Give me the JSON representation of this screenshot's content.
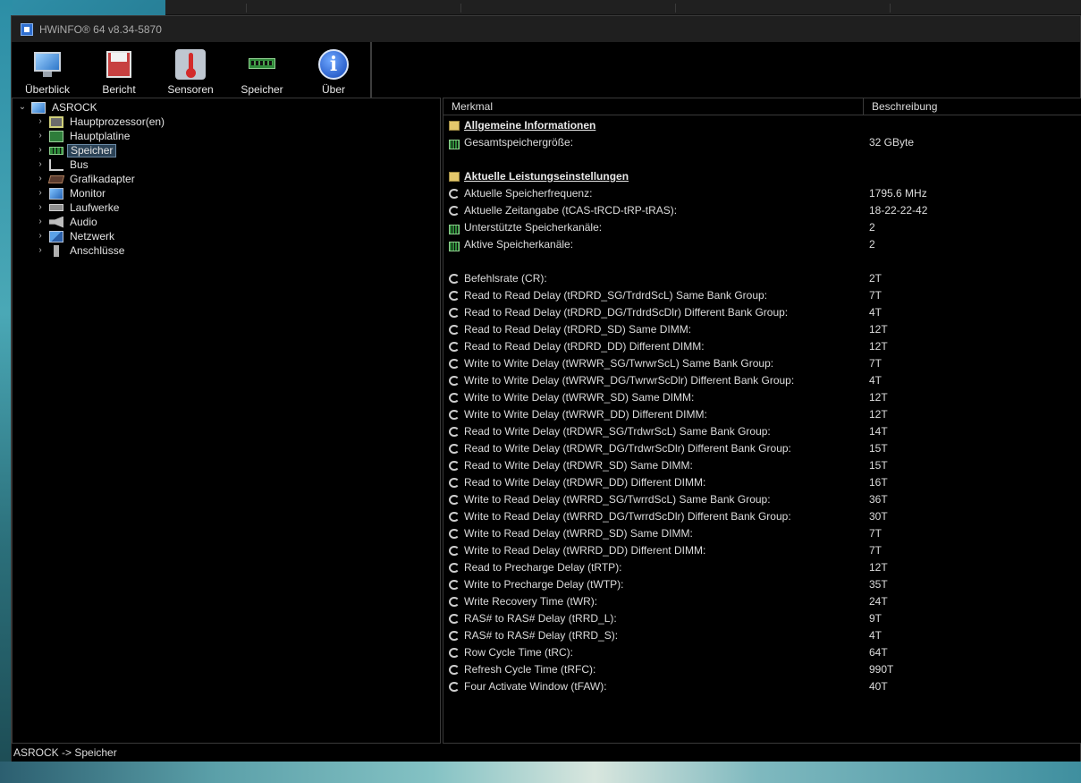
{
  "window": {
    "title": "HWiNFO® 64 v8.34-5870"
  },
  "toolbar": {
    "buttons": [
      {
        "label": "Überblick",
        "icon": "monitor-icon"
      },
      {
        "label": "Bericht",
        "icon": "floppy-icon"
      },
      {
        "label": "Sensoren",
        "icon": "thermometer-icon"
      },
      {
        "label": "Speicher",
        "icon": "ram-icon"
      },
      {
        "label": "Über",
        "icon": "info-icon"
      }
    ]
  },
  "tree": {
    "root": "ASROCK",
    "items": [
      {
        "label": "Hauptprozessor(en)",
        "icon": "cpu-icon"
      },
      {
        "label": "Hauptplatine",
        "icon": "motherboard-icon"
      },
      {
        "label": "Speicher",
        "icon": "ram-icon",
        "selected": true
      },
      {
        "label": "Bus",
        "icon": "bus-icon"
      },
      {
        "label": "Grafikadapter",
        "icon": "gpu-icon"
      },
      {
        "label": "Monitor",
        "icon": "monitor-icon"
      },
      {
        "label": "Laufwerke",
        "icon": "drive-icon"
      },
      {
        "label": "Audio",
        "icon": "audio-icon"
      },
      {
        "label": "Netzwerk",
        "icon": "network-icon"
      },
      {
        "label": "Anschlüsse",
        "icon": "port-icon"
      }
    ]
  },
  "detail": {
    "headers": {
      "feature": "Merkmal",
      "description": "Beschreibung"
    },
    "rows": [
      {
        "label": "Allgemeine Informationen",
        "value": "",
        "type": "section",
        "icon": "section-icon"
      },
      {
        "label": "Gesamtspeichergröße:",
        "value": "32 GByte",
        "type": "row",
        "icon": "ram-icon"
      },
      {
        "label": "",
        "value": "",
        "type": "blank",
        "icon": ""
      },
      {
        "label": "Aktuelle Leistungseinstellungen",
        "value": "",
        "type": "section",
        "icon": "section-icon"
      },
      {
        "label": "Aktuelle Speicherfrequenz:",
        "value": "1795.6 MHz",
        "type": "row",
        "icon": "clock-icon"
      },
      {
        "label": "Aktuelle Zeitangabe (tCAS-tRCD-tRP-tRAS):",
        "value": "18-22-22-42",
        "type": "row",
        "icon": "clock-icon"
      },
      {
        "label": "Unterstützte Speicherkanäle:",
        "value": "2",
        "type": "row",
        "icon": "ram-icon"
      },
      {
        "label": "Aktive Speicherkanäle:",
        "value": "2",
        "type": "row",
        "icon": "ram-icon"
      },
      {
        "label": "",
        "value": "",
        "type": "blank",
        "icon": ""
      },
      {
        "label": "Befehlsrate (CR):",
        "value": "2T",
        "type": "row",
        "icon": "clock-icon"
      },
      {
        "label": "Read to Read Delay (tRDRD_SG/TrdrdScL) Same Bank Group:",
        "value": "7T",
        "type": "row",
        "icon": "clock-icon"
      },
      {
        "label": "Read to Read Delay (tRDRD_DG/TrdrdScDlr) Different Bank Group:",
        "value": "4T",
        "type": "row",
        "icon": "clock-icon"
      },
      {
        "label": "Read to Read Delay (tRDRD_SD) Same DIMM:",
        "value": "12T",
        "type": "row",
        "icon": "clock-icon"
      },
      {
        "label": "Read to Read Delay (tRDRD_DD) Different DIMM:",
        "value": "12T",
        "type": "row",
        "icon": "clock-icon"
      },
      {
        "label": "Write to Write Delay (tWRWR_SG/TwrwrScL) Same Bank Group:",
        "value": "7T",
        "type": "row",
        "icon": "clock-icon"
      },
      {
        "label": "Write to Write Delay (tWRWR_DG/TwrwrScDlr) Different Bank Group:",
        "value": "4T",
        "type": "row",
        "icon": "clock-icon"
      },
      {
        "label": "Write to Write Delay (tWRWR_SD) Same DIMM:",
        "value": "12T",
        "type": "row",
        "icon": "clock-icon"
      },
      {
        "label": "Write to Write Delay (tWRWR_DD) Different DIMM:",
        "value": "12T",
        "type": "row",
        "icon": "clock-icon"
      },
      {
        "label": "Read to Write Delay (tRDWR_SG/TrdwrScL) Same Bank Group:",
        "value": "14T",
        "type": "row",
        "icon": "clock-icon"
      },
      {
        "label": "Read to Write Delay (tRDWR_DG/TrdwrScDlr) Different Bank Group:",
        "value": "15T",
        "type": "row",
        "icon": "clock-icon"
      },
      {
        "label": "Read to Write Delay (tRDWR_SD) Same DIMM:",
        "value": "15T",
        "type": "row",
        "icon": "clock-icon"
      },
      {
        "label": "Read to Write Delay (tRDWR_DD) Different DIMM:",
        "value": "16T",
        "type": "row",
        "icon": "clock-icon"
      },
      {
        "label": "Write to Read Delay (tWRRD_SG/TwrrdScL) Same Bank Group:",
        "value": "36T",
        "type": "row",
        "icon": "clock-icon"
      },
      {
        "label": "Write to Read Delay (tWRRD_DG/TwrrdScDlr) Different Bank Group:",
        "value": "30T",
        "type": "row",
        "icon": "clock-icon"
      },
      {
        "label": "Write to Read Delay (tWRRD_SD) Same DIMM:",
        "value": "7T",
        "type": "row",
        "icon": "clock-icon"
      },
      {
        "label": "Write to Read Delay (tWRRD_DD) Different DIMM:",
        "value": "7T",
        "type": "row",
        "icon": "clock-icon"
      },
      {
        "label": "Read to Precharge Delay (tRTP):",
        "value": "12T",
        "type": "row",
        "icon": "clock-icon"
      },
      {
        "label": "Write to Precharge Delay (tWTP):",
        "value": "35T",
        "type": "row",
        "icon": "clock-icon"
      },
      {
        "label": "Write Recovery Time (tWR):",
        "value": "24T",
        "type": "row",
        "icon": "clock-icon"
      },
      {
        "label": "RAS# to RAS# Delay (tRRD_L):",
        "value": "9T",
        "type": "row",
        "icon": "clock-icon"
      },
      {
        "label": "RAS# to RAS# Delay (tRRD_S):",
        "value": "4T",
        "type": "row",
        "icon": "clock-icon"
      },
      {
        "label": "Row Cycle Time (tRC):",
        "value": "64T",
        "type": "row",
        "icon": "clock-icon"
      },
      {
        "label": "Refresh Cycle Time (tRFC):",
        "value": "990T",
        "type": "row",
        "icon": "clock-icon"
      },
      {
        "label": "Four Activate Window (tFAW):",
        "value": "40T",
        "type": "row",
        "icon": "clock-icon"
      }
    ]
  },
  "status": {
    "path": "ASROCK -> Speicher"
  }
}
